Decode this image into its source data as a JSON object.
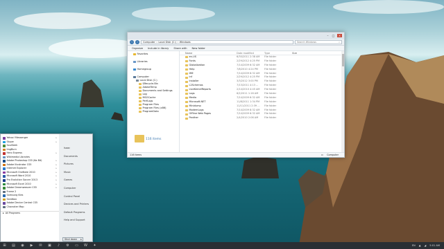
{
  "explorer": {
    "breadcrumb": [
      "Computer",
      "Local Disk (C:)",
      "Windows"
    ],
    "search_placeholder": "Search Windows",
    "commands": [
      "Organize",
      "Include in library",
      "Share with",
      "New folder"
    ],
    "columns": [
      "Name",
      "Date modified",
      "Type",
      "Size"
    ],
    "nav": [
      {
        "label": "Favorites",
        "icon": "star-icon",
        "indent": 0
      },
      {
        "label": "Libraries",
        "icon": "library-icon",
        "indent": 0
      },
      {
        "label": "Homegroup",
        "icon": "homegroup-icon",
        "indent": 0
      },
      {
        "label": "Computer",
        "icon": "computer-icon",
        "indent": 0
      },
      {
        "label": "Local Disk (C:)",
        "icon": "drive-icon",
        "indent": 1
      },
      {
        "label": "$Recycle.Bin",
        "icon": "folder-icon",
        "indent": 2
      },
      {
        "label": "AdobeTemp",
        "icon": "folder-icon",
        "indent": 2
      },
      {
        "label": "Documents and Settings",
        "icon": "folder-icon",
        "indent": 2
      },
      {
        "label": "Log",
        "icon": "folder-icon",
        "indent": 2
      },
      {
        "label": "MSOCache",
        "icon": "folder-icon",
        "indent": 2
      },
      {
        "label": "PerfLogs",
        "icon": "folder-icon",
        "indent": 2
      },
      {
        "label": "Program Files",
        "icon": "folder-icon",
        "indent": 2
      },
      {
        "label": "Program Files (x86)",
        "icon": "folder-icon",
        "indent": 2
      },
      {
        "label": "ProgramData",
        "icon": "folder-icon",
        "indent": 2
      }
    ],
    "rows": [
      {
        "name": "en-US",
        "date": "6/30/2011 2:38 AM",
        "type": "File folder"
      },
      {
        "name": "Fonts",
        "date": "2/29/2012 4:25 PM",
        "type": "File folder"
      },
      {
        "name": "Globalization",
        "date": "7/14/2009 6:32 AM",
        "type": "File folder"
      },
      {
        "name": "Help",
        "date": "7/8/2010 4:24 PM",
        "type": "File folder"
      },
      {
        "name": "IME",
        "date": "7/14/2009 8:32 AM",
        "type": "File folder"
      },
      {
        "name": "inf",
        "date": "2/29/2012 4:25 PM",
        "type": "File folder"
      },
      {
        "name": "Installer",
        "date": "3/3/2012 3:00 PM",
        "type": "File folder"
      },
      {
        "name": "L2Schemas",
        "date": "7/13/2011 4:13 ...",
        "type": "File folder"
      },
      {
        "name": "LiveKernelReports",
        "date": "2/14/2010 4:45 AM",
        "type": "File folder"
      },
      {
        "name": "Logs",
        "date": "6/2/2011 1:16 AM",
        "type": "File folder"
      },
      {
        "name": "Media",
        "date": "7/14/2009 6:32 AM",
        "type": "File folder"
      },
      {
        "name": "Microsoft.NET",
        "date": "11/8/2011 1:34 PM",
        "type": "File folder"
      },
      {
        "name": "Minidump",
        "date": "11/11/2011 2:39 ...",
        "type": "File folder"
      },
      {
        "name": "ModemLogs",
        "date": "7/14/2009 8:32 AM",
        "type": "File folder"
      },
      {
        "name": "Offline Web Pages",
        "date": "7/14/2009 6:32 AM",
        "type": "File folder"
      },
      {
        "name": "Panther",
        "date": "2/4/2010 2:06 AM",
        "type": "File folder"
      }
    ],
    "big_count": "116 items",
    "status": "116 items",
    "status_right": "Computer"
  },
  "start": {
    "items": [
      {
        "label": "Yahoo! Messenger",
        "color": "#7b3fa0",
        "arrow": true
      },
      {
        "label": "Skype",
        "color": "#1fa0e0",
        "arrow": true
      },
      {
        "label": "SoulSeek",
        "color": "#4a8c3a",
        "arrow": false
      },
      {
        "label": "ImgBurn",
        "color": "#d08020",
        "arrow": false
      },
      {
        "label": "Hero Express",
        "color": "#c03030",
        "arrow": true
      },
      {
        "label": "Wikimedia Libraries",
        "color": "#6090c0",
        "arrow": false
      },
      {
        "label": "Adobe Photoshop CS5 (6a Bit)",
        "color": "#1a4d8a",
        "arrow": true
      },
      {
        "label": "Adobe Illustrator CS5",
        "color": "#d07010",
        "arrow": true
      },
      {
        "label": "Internet Explorer",
        "color": "#2a7ad0",
        "arrow": true
      },
      {
        "label": "Microsoft OneNote 2010",
        "color": "#8a3aa0",
        "arrow": true
      },
      {
        "label": "Microsoft Word 2010",
        "color": "#2a5aa8",
        "arrow": true
      },
      {
        "label": "Pro Evolution Soccer 2013",
        "color": "#1a3a8a",
        "arrow": true
      },
      {
        "label": "Microsoft Excel 2010",
        "color": "#2a8a3a",
        "arrow": true
      },
      {
        "label": "Adobe Dreamweaver CS5",
        "color": "#3a8a3a",
        "arrow": true
      },
      {
        "label": "Frame 2",
        "color": "#607080",
        "arrow": false
      },
      {
        "label": "Samsung Kies",
        "color": "#2a6ab0",
        "arrow": false
      },
      {
        "label": "Sandbox",
        "color": "#d0a020",
        "arrow": false
      },
      {
        "label": "Adobe Device Central CS5",
        "color": "#6a4aa0",
        "arrow": false
      },
      {
        "label": "Character Map",
        "color": "#607080",
        "arrow": false
      }
    ],
    "right": [
      "Isaac",
      "Documents",
      "Pictures",
      "Music",
      "Games",
      "Computer",
      "Control Panel",
      "Devices and Printers",
      "Default Programs",
      "Help and Support"
    ],
    "all_programs": "All Programs",
    "search_placeholder": "Search programs and files",
    "shutdown": "Shut down"
  },
  "taskbar": {
    "tray_text": "EN",
    "clock": "5:01 AM"
  }
}
